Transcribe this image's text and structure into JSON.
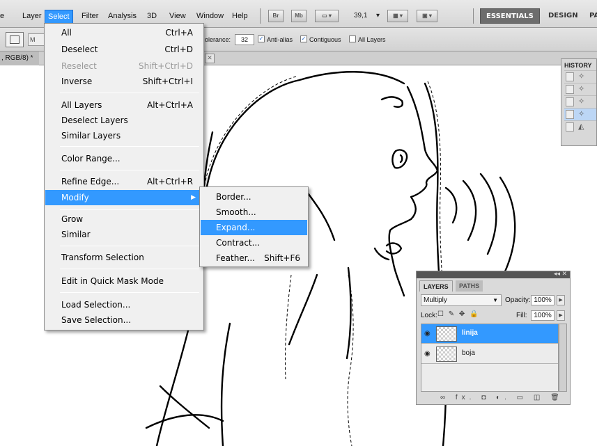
{
  "menubar": {
    "items": [
      "e",
      "Layer",
      "Select",
      "Filter",
      "Analysis",
      "3D",
      "View",
      "Window",
      "Help"
    ],
    "active_item": "Select",
    "br_label": "Br",
    "mb_label": "Mb",
    "zoom": "39,1",
    "workspaces": [
      "ESSENTIALS",
      "DESIGN",
      "PA"
    ]
  },
  "options": {
    "mode_label": "M",
    "tolerance_label": "olerance:",
    "tolerance_value": "32",
    "antialias_label": "Anti-alias",
    "contiguous_label": "Contiguous",
    "all_layers_label": "All Layers"
  },
  "document": {
    "tab_label": ", RGB/8) *"
  },
  "select_menu": {
    "items": [
      {
        "label": "All",
        "shortcut": "Ctrl+A"
      },
      {
        "label": "Deselect",
        "shortcut": "Ctrl+D"
      },
      {
        "label": "Reselect",
        "shortcut": "Shift+Ctrl+D"
      },
      {
        "label": "Inverse",
        "shortcut": "Shift+Ctrl+I"
      },
      {
        "label": "All Layers",
        "shortcut": "Alt+Ctrl+A"
      },
      {
        "label": "Deselect Layers",
        "shortcut": ""
      },
      {
        "label": "Similar Layers",
        "shortcut": ""
      },
      {
        "label": "Color Range...",
        "shortcut": ""
      },
      {
        "label": "Refine Edge...",
        "shortcut": "Alt+Ctrl+R"
      },
      {
        "label": "Modify",
        "shortcut": ""
      },
      {
        "label": "Grow",
        "shortcut": ""
      },
      {
        "label": "Similar",
        "shortcut": ""
      },
      {
        "label": "Transform Selection",
        "shortcut": ""
      },
      {
        "label": "Edit in Quick Mask Mode",
        "shortcut": ""
      },
      {
        "label": "Load Selection...",
        "shortcut": ""
      },
      {
        "label": "Save Selection...",
        "shortcut": ""
      }
    ]
  },
  "modify_submenu": {
    "items": [
      {
        "label": "Border...",
        "shortcut": ""
      },
      {
        "label": "Smooth...",
        "shortcut": ""
      },
      {
        "label": "Expand...",
        "shortcut": ""
      },
      {
        "label": "Contract...",
        "shortcut": ""
      },
      {
        "label": "Feather...",
        "shortcut": "Shift+F6"
      }
    ]
  },
  "history_panel": {
    "title": "HISTORY"
  },
  "layers_panel": {
    "tabs": [
      "LAYERS",
      "PATHS"
    ],
    "blend_mode": "Multiply",
    "opacity_label": "Opacity:",
    "opacity_value": "100%",
    "lock_label": "Lock:",
    "fill_label": "Fill:",
    "fill_value": "100%",
    "layers": [
      {
        "name": "linija",
        "selected": true
      },
      {
        "name": "boja",
        "selected": false
      }
    ],
    "bottom_icons": "∞ fx. ◘ ◐. ▭ ◫ 🗑"
  },
  "colors": {
    "highlight": "#3399ff",
    "menu_bg": "#f0f0f0",
    "workspace_active": "#6d6d6d"
  }
}
